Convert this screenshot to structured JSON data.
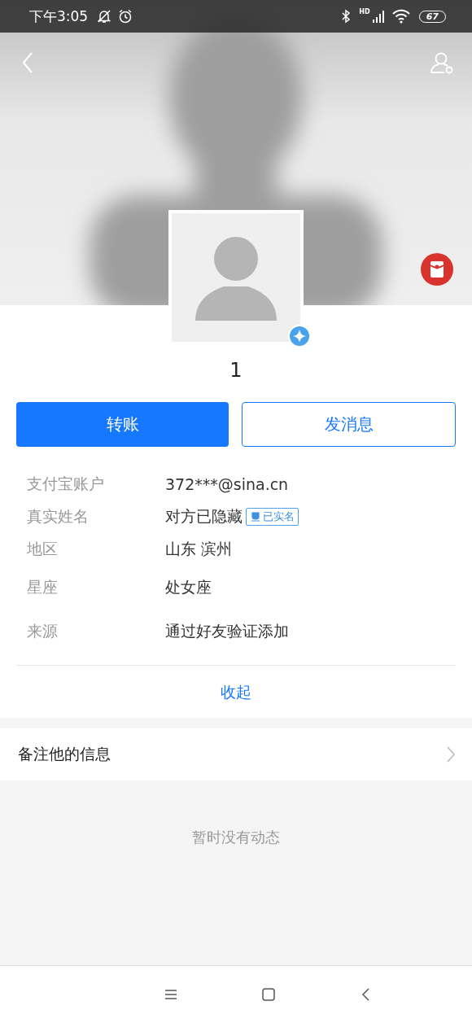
{
  "status_bar": {
    "time": "下午3:05",
    "network": "HD",
    "battery": "67"
  },
  "profile": {
    "name": "1",
    "verified": true
  },
  "buttons": [
    {
      "label": "转账",
      "kind": "primary"
    },
    {
      "label": "发消息",
      "kind": "outline"
    }
  ],
  "info": [
    {
      "label": "支付宝账户",
      "value": "372***@sina.cn"
    },
    {
      "label": "真实姓名",
      "value": "对方已隐藏",
      "tag": "已实名"
    },
    {
      "label": "地区",
      "value": "山东 滨州"
    },
    {
      "label": "星座",
      "value": "处女座"
    },
    {
      "label": "来源",
      "value": "通过好友验证添加"
    }
  ],
  "collapse_link": "收起",
  "remark_row": {
    "label": "备注他的信息"
  },
  "empty_feed": "暂时没有动态"
}
